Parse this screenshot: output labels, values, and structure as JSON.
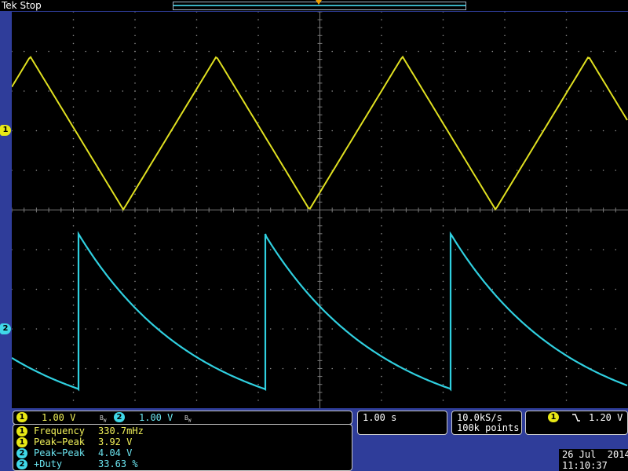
{
  "header": {
    "brand": "Tek",
    "state": "Stop"
  },
  "channels": [
    {
      "id": "1",
      "scale": "1.00 V",
      "color": "#e8e815",
      "bandwidth_icon": "B_W"
    },
    {
      "id": "2",
      "scale": "1.00 V",
      "color": "#40d8e8",
      "bandwidth_icon": "B_W"
    }
  ],
  "horizontal": {
    "time_per_div": "1.00 s"
  },
  "acquisition": {
    "sample_rate": "10.0kS/s",
    "record_length": "100k points"
  },
  "trigger": {
    "source": "1",
    "slope_icon": "falling-edge-icon",
    "level": "1.20 V"
  },
  "measurements": [
    {
      "channel": "1",
      "name": "Frequency",
      "value": "330.7mHz"
    },
    {
      "channel": "1",
      "name": "Peak−Peak",
      "value": "3.92 V"
    },
    {
      "channel": "2",
      "name": "Peak−Peak",
      "value": "4.04 V"
    },
    {
      "channel": "2",
      "name": "+Duty",
      "value": "33.63 %"
    }
  ],
  "datetime": {
    "date": "26 Jul  2014",
    "time": "11:10:37"
  },
  "waveforms": {
    "ch1": {
      "shape": "triangle",
      "period_div": 3.02,
      "peak_to_peak_v": 3.92
    },
    "ch2": {
      "shape": "exponential-decay-sawtooth",
      "period_div": 3.02,
      "peak_to_peak_v": 4.04,
      "duty_percent": 33.63
    }
  }
}
